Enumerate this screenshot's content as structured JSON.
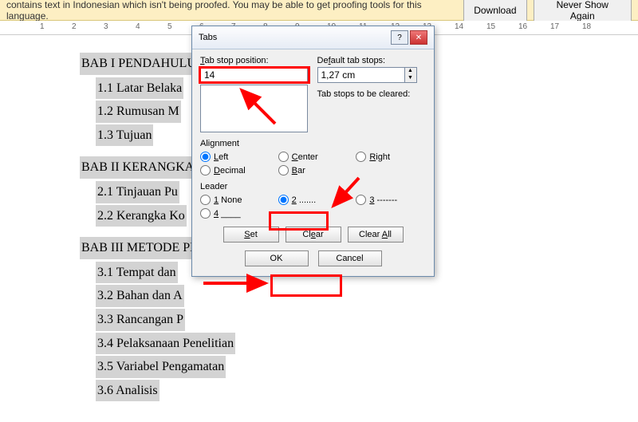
{
  "proofing": {
    "message": "contains text in Indonesian which isn't being proofed. You may be able to get proofing tools for this language.",
    "download": "Download",
    "never": "Never Show Again"
  },
  "ruler": {
    "marks": [
      "1",
      "2",
      "3",
      "4",
      "5",
      "6",
      "7",
      "8",
      "9",
      "10",
      "11",
      "12",
      "13",
      "14",
      "15",
      "16",
      "17",
      "18"
    ]
  },
  "doc": {
    "bab1": "BAB I PENDAHULU",
    "s11": "1.1 Latar Belaka",
    "s12": "1.2 Rumusan M",
    "s13": "1.3 Tujuan",
    "bab2": "BAB II KERANGKA",
    "s21": "2.1 Tinjauan Pu",
    "s22": "2.2 Kerangka Ko",
    "bab3": "BAB III METODE PE",
    "s31": "3.1 Tempat dan",
    "s32": "3.2 Bahan dan A",
    "s33": "3.3 Rancangan P",
    "s34": "3.4 Pelaksanaan Penelitian",
    "s35": "3.5 Variabel Pengamatan",
    "s36": "3.6 Analisis"
  },
  "dialog": {
    "title": "Tabs",
    "tab_stop_label": "Tab stop position:",
    "tab_stop_value": "14",
    "default_label": "Default tab stops:",
    "default_value": "1,27 cm",
    "cleared_label": "Tab stops to be cleared:",
    "alignment_label": "Alignment",
    "align": {
      "left": "Left",
      "center": "Center",
      "right": "Right",
      "decimal": "Decimal",
      "bar": "Bar"
    },
    "leader_label": "Leader",
    "leader": {
      "none": "1 None",
      "dots": "2 .......",
      "dashes": "3 -------",
      "under": "4 ____"
    },
    "set": "Set",
    "clear": "Clear",
    "clear_all": "Clear All",
    "ok": "OK",
    "cancel": "Cancel"
  }
}
